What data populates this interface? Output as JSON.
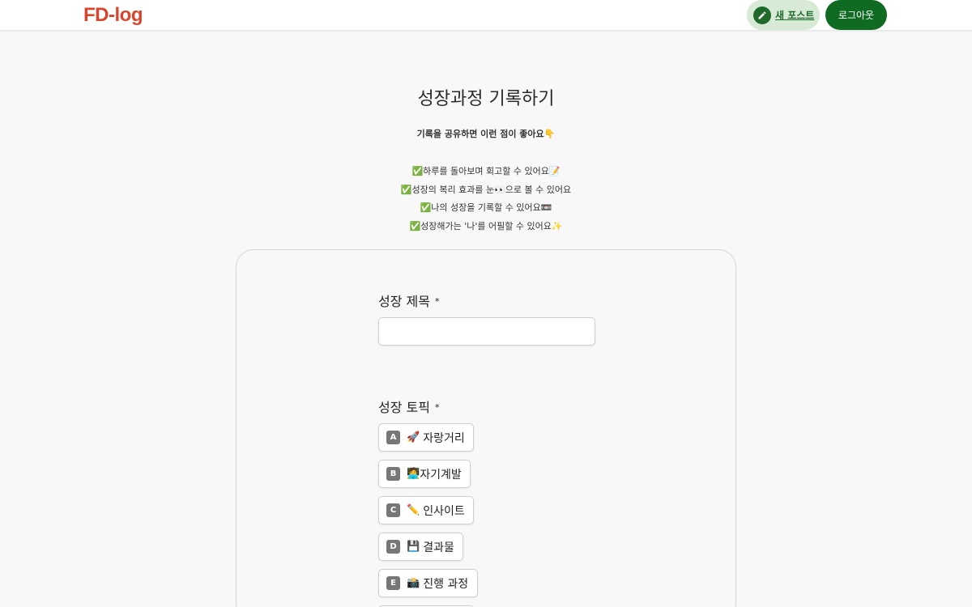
{
  "header": {
    "logo_text": "FD-log",
    "logo_subtext": "",
    "new_post_label": "새 포스트",
    "logout_label": "로그아웃"
  },
  "intro": {
    "title": "성장과정 기록하기",
    "subtitle": "기록을 공유하면 이런 점이 좋아요👇",
    "benefits": [
      "✅하루를 돌아보며 회고할 수 있어요📝",
      "✅성장의 복리 효과를 눈👀으로 볼 수 있어요",
      "✅나의 성장을 기록할 수 있어요📼",
      "✅성장해가는 '나'를 어필할 수 있어요✨"
    ]
  },
  "form": {
    "title_label": "성장 제목",
    "title_required": "*",
    "title_value": "",
    "topic_label": "성장 토픽",
    "topic_required": "*",
    "topics": [
      {
        "key": "A",
        "icon": "🚀",
        "text": "자랑거리"
      },
      {
        "key": "B",
        "icon": "🧑‍💻",
        "text": "자기계발"
      },
      {
        "key": "C",
        "icon": "✏️",
        "text": "인사이트"
      },
      {
        "key": "D",
        "icon": "💾",
        "text": "결과물"
      },
      {
        "key": "E",
        "icon": "📸",
        "text": "진행 과정"
      },
      {
        "key": "F",
        "icon": "",
        "text": ""
      }
    ]
  },
  "colors": {
    "brand": "#d9452c",
    "primary_green": "#0f6b22",
    "light_green": "#d6ead6"
  }
}
